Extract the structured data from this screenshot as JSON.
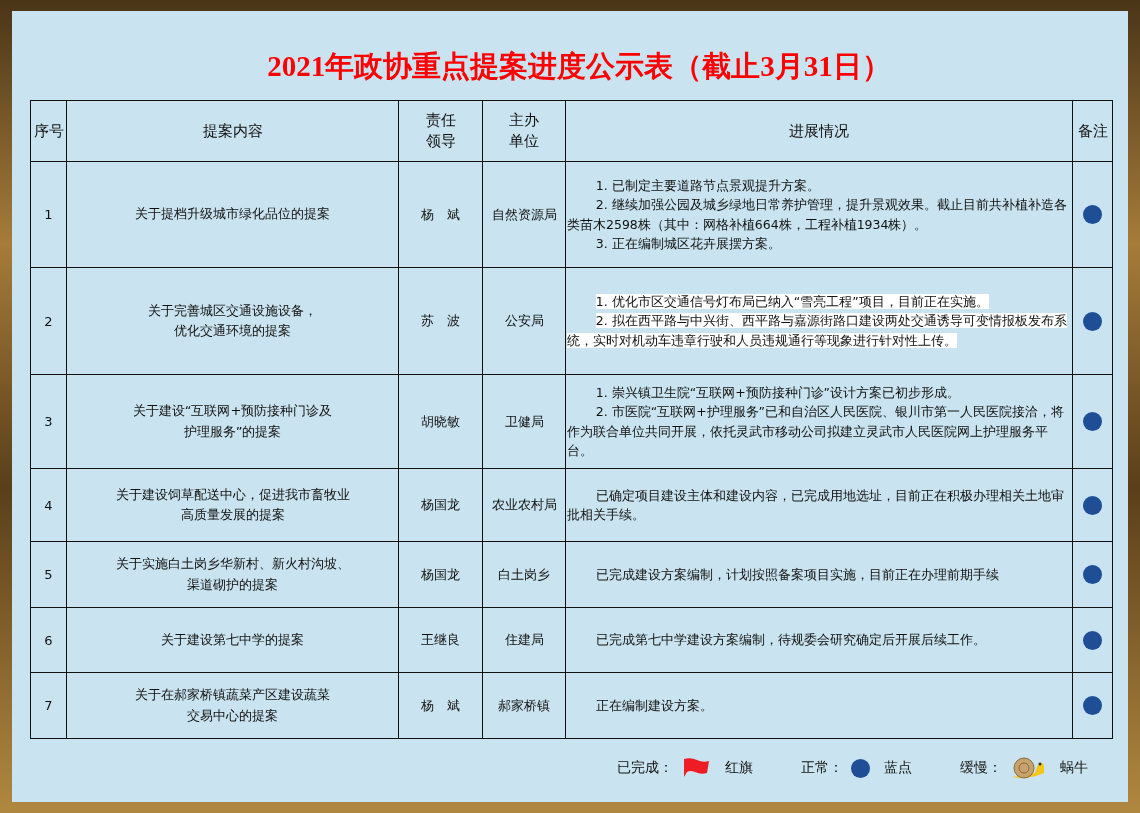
{
  "title": "2021年政协重点提案进度公示表（截止3月31日）",
  "table": {
    "columns": [
      "序号",
      "提案内容",
      "责任领导",
      "主办单位",
      "进展情况",
      "备注"
    ],
    "rows": [
      {
        "no": "1",
        "proposal": [
          "关于提档升级城市绿化品位的提案"
        ],
        "leader": "杨　斌",
        "unit": "自然资源局",
        "progress": [
          "1. 已制定主要道路节点景观提升方案。",
          "2. 继续加强公园及城乡绿地日常养护管理，提升景观效果。截止目前共补植补造各类苗木2598株（其中：网格补植664株，工程补植1934株）。",
          "3. 正在编制城区花卉展摆方案。"
        ],
        "highlighted": false,
        "kind": "dot",
        "color": "#1f4e96"
      },
      {
        "no": "2",
        "proposal": [
          "关于完善城区交通设施设备，",
          "优化交通环境的提案"
        ],
        "leader": "苏　波",
        "unit": "公安局",
        "progress": [
          "1. 优化市区交通信号灯布局已纳入“雪亮工程”项目，目前正在实施。",
          "2. 拟在西平路与中兴街、西平路与嘉源街路口建设两处交通诱导可变情报板发布系统，实时对机动车违章行驶和人员违规通行等现象进行针对性上传。"
        ],
        "highlighted": true,
        "kind": "dot",
        "color": "#1f4e96"
      },
      {
        "no": "3",
        "proposal": [
          "关于建设“互联网+预防接种门诊及",
          "护理服务”的提案"
        ],
        "leader": "胡晓敏",
        "unit": "卫健局",
        "progress": [
          "1. 崇兴镇卫生院“互联网+预防接种门诊”设计方案已初步形成。",
          "2. 市医院“互联网+护理服务”已和自治区人民医院、银川市第一人民医院接洽，将作为联合单位共同开展，依托灵武市移动公司拟建立灵武市人民医院网上护理服务平台。"
        ],
        "highlighted": false,
        "kind": "dot",
        "color": "#1f4e96"
      },
      {
        "no": "4",
        "proposal": [
          "关于建设饲草配送中心，促进我市畜牧业",
          "高质量发展的提案"
        ],
        "leader": "杨国龙",
        "unit": "农业农村局",
        "progress": [
          "已确定项目建设主体和建设内容，已完成用地选址，目前正在积极办理相关土地审批相关手续。"
        ],
        "highlighted": false,
        "kind": "dot",
        "color": "#1f4e96"
      },
      {
        "no": "5",
        "proposal": [
          "关于实施白土岗乡华新村、新火村沟坡、",
          "渠道砌护的提案"
        ],
        "leader": "杨国龙",
        "unit": "白土岗乡",
        "progress": [
          "已完成建设方案编制，计划按照备案项目实施，目前正在办理前期手续"
        ],
        "highlighted": false,
        "kind": "dot",
        "color": "#1f4e96"
      },
      {
        "no": "6",
        "proposal": [
          "关于建设第七中学的提案"
        ],
        "leader": "王继良",
        "unit": "住建局",
        "progress": [
          "已完成第七中学建设方案编制，待规委会研究确定后开展后续工作。"
        ],
        "highlighted": false,
        "kind": "dot",
        "color": "#1f4e96"
      },
      {
        "no": "7",
        "proposal": [
          "关于在郝家桥镇蔬菜产区建设蔬菜",
          "交易中心的提案"
        ],
        "leader": "杨　斌",
        "unit": "郝家桥镇",
        "progress": [
          "正在编制建设方案。"
        ],
        "highlighted": false,
        "kind": "dot",
        "color": "#1f4e96"
      }
    ]
  },
  "legend": [
    {
      "label": "已完成：",
      "kind": "flag",
      "name": "红旗"
    },
    {
      "label": "正常：",
      "kind": "dot",
      "name": "蓝点"
    },
    {
      "label": "缓慢：",
      "kind": "snail",
      "name": "蜗牛"
    }
  ]
}
